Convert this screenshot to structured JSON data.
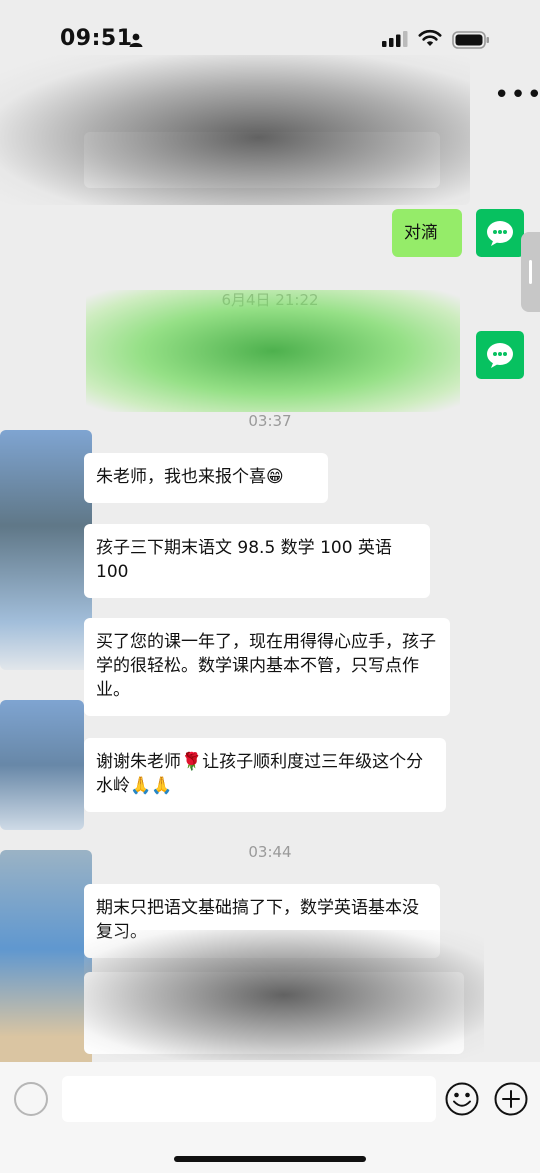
{
  "status": {
    "time": "09:51"
  },
  "messages": [
    {
      "from": "me",
      "text": "对滴"
    },
    {
      "timestamp": "6月4日 21:22"
    },
    {
      "timestamp": "03:37"
    },
    {
      "from": "other",
      "text": "朱老师，我也来报个喜😁"
    },
    {
      "from": "other",
      "text": "孩子三下期末语文 98.5 数学 100 英语 100"
    },
    {
      "from": "other",
      "text": "买了您的课一年了，现在用得得心应手，孩子学的很轻松。数学课内基本不管，只写点作业。"
    },
    {
      "from": "other",
      "text": "谢谢朱老师🌹让孩子顺利度过三年级这个分水岭🙏🙏"
    },
    {
      "timestamp": "03:44"
    },
    {
      "from": "other",
      "text": "期末只把语文基础搞了下，数学英语基本没复习。"
    }
  ],
  "colors": {
    "my_bubble": "#95ec69",
    "other_bubble": "#ffffff",
    "accent_avatar": "#07c160",
    "background": "#ededed"
  },
  "icons": [
    "person-icon",
    "signal-icon",
    "wifi-icon",
    "battery-icon",
    "more-icon",
    "wechat-avatar-icon",
    "voice-icon",
    "emoji-icon",
    "plus-icon"
  ]
}
